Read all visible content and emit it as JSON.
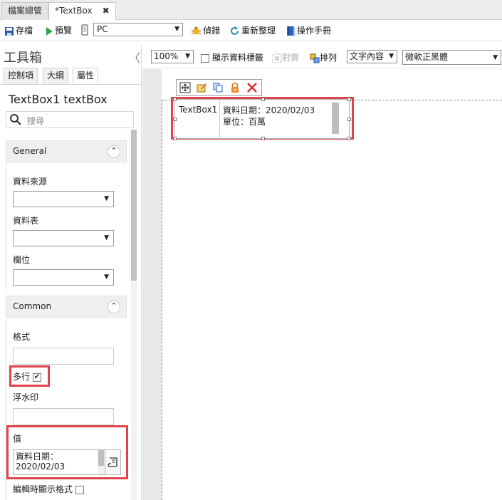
{
  "tabs": [
    {
      "label": "檔案總管"
    },
    {
      "label": "*TextBox",
      "close": "✖"
    }
  ],
  "toolbar": {
    "save": "存檔",
    "preview": "預覽",
    "device": "PC",
    "debug": "偵錯",
    "refresh": "重新整理",
    "manual": "操作手冊"
  },
  "toolbox": {
    "title": "工具箱",
    "collapse": "〈",
    "tabs": [
      "控制項",
      "大綱",
      "屬性"
    ],
    "component_title": "TextBox1 textBox",
    "search_placeholder": "搜尋",
    "general": {
      "title": "General",
      "toggle": "⌃",
      "fields": [
        "資料來源",
        "資料表",
        "欄位"
      ]
    },
    "common": {
      "title": "Common",
      "toggle": "⌃",
      "format_label": "格式",
      "multiline_label": "多行",
      "multiline_checked": true,
      "watermark_label": "浮水印",
      "value_label": "值",
      "value_text": "資料日期：\n2020/02/03",
      "edit_show_format_label": "編輯時顯示格式"
    }
  },
  "designer": {
    "zoom": "100%",
    "show_tags_label": "顯示資料標籤",
    "align_label": "對齊",
    "arrange_label": "排列",
    "text_mode": "文字內容",
    "font": "微軟正黑體"
  },
  "textbox": {
    "name": "TextBox1",
    "value_line1": "資料日期：2020/02/03",
    "value_line2": "單位：百萬"
  },
  "colors": {
    "highlight": "#e0434b",
    "save_icon": "#2a5db0",
    "preview_icon": "#2aa84a",
    "delete_icon": "#e03030"
  }
}
